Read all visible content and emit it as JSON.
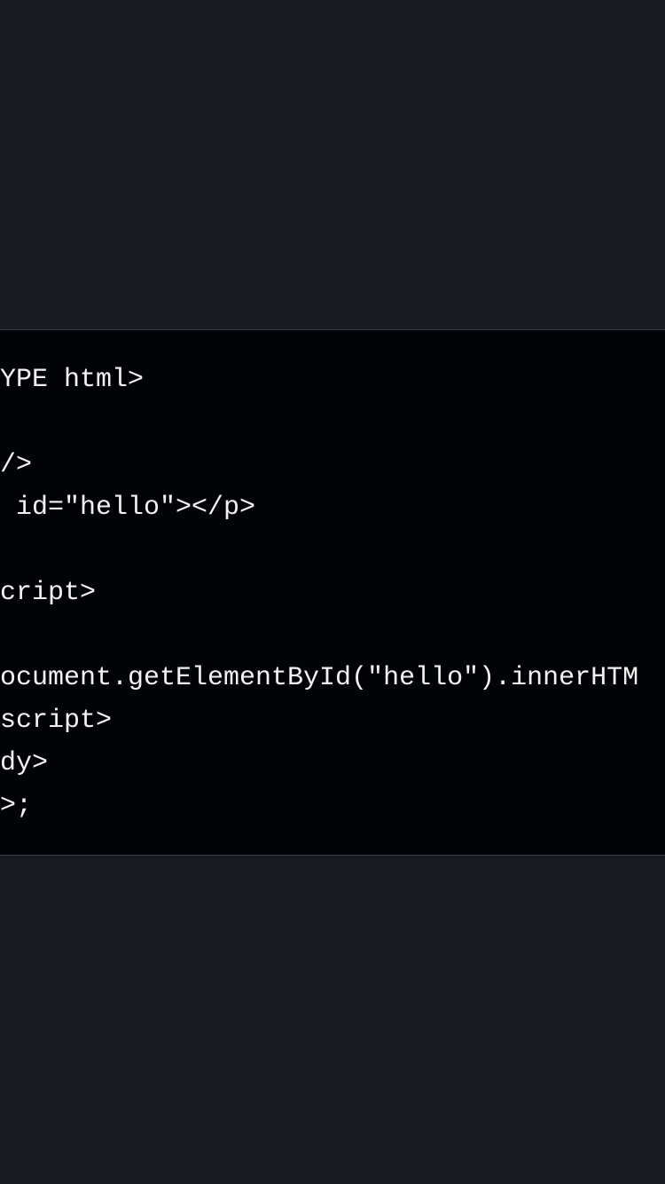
{
  "code_block": {
    "lines": [
      "YPE html>",
      "",
      "/>",
      " id=\"hello\"></p>",
      "",
      "cript>",
      "",
      "ocument.getElementById(\"hello\").innerHTM",
      "script>",
      "dy>",
      ">;"
    ]
  }
}
